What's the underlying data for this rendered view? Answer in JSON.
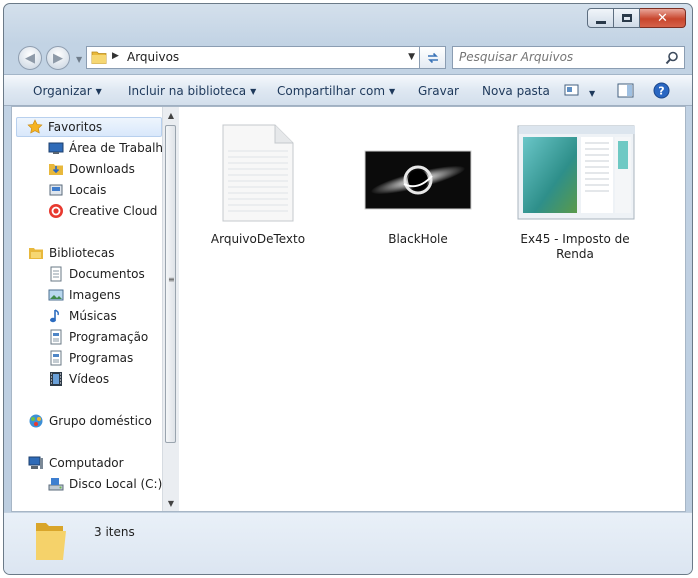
{
  "window": {
    "controls": {
      "minimize_icon": "minimize-icon",
      "maximize_icon": "maximize-icon",
      "close_icon": "close-icon"
    }
  },
  "address": {
    "location": "Arquivos"
  },
  "search": {
    "placeholder": "Pesquisar Arquivos"
  },
  "toolbar": {
    "organize": "Organizar",
    "include_library": "Incluir na biblioteca",
    "share_with": "Compartilhar com",
    "burn": "Gravar",
    "new_folder": "Nova pasta"
  },
  "sidebar": {
    "favorites": "Favoritos",
    "desktop": "Área de Trabalho",
    "downloads": "Downloads",
    "places": "Locais",
    "creative_cloud": "Creative Cloud Files",
    "libraries": "Bibliotecas",
    "documents": "Documentos",
    "images": "Imagens",
    "music": "Músicas",
    "programming": "Programação",
    "programs": "Programas",
    "videos": "Vídeos",
    "homegroup": "Grupo doméstico",
    "computer": "Computador",
    "local_disk": "Disco Local (C:)"
  },
  "files": [
    {
      "name": "ArquivoDeTexto",
      "icon": "text-file-icon"
    },
    {
      "name": "BlackHole",
      "icon": "image-thumbnail"
    },
    {
      "name": "Ex45 - Imposto de Renda",
      "icon": "app-window-thumbnail"
    }
  ],
  "status": {
    "item_count": "3 itens"
  },
  "colors": {
    "toolbar_text": "#1e395b",
    "selection": "#d9e8fb",
    "close_button": "#c8462d"
  }
}
